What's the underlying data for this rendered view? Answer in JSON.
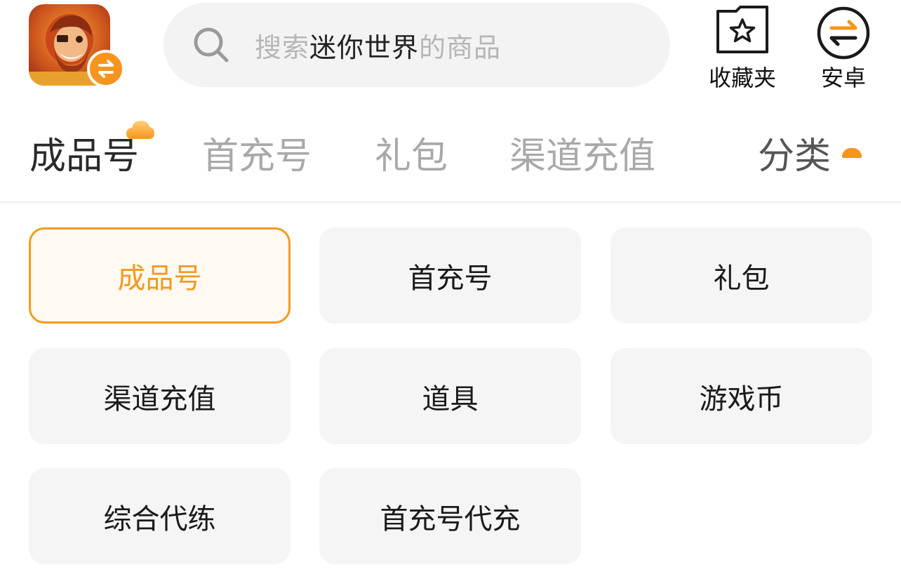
{
  "header": {
    "app_icon_name": "game-app-icon",
    "search": {
      "prefix": "搜索",
      "game": "迷你世界",
      "suffix": "的商品"
    },
    "favorites_label": "收藏夹",
    "platform_label": "安卓"
  },
  "tabs": {
    "items": [
      "成品号",
      "首充号",
      "礼包",
      "渠道充值"
    ],
    "active": "成品号",
    "category_label": "分类"
  },
  "categories": [
    {
      "label": "成品号",
      "selected": true
    },
    {
      "label": "首充号",
      "selected": false
    },
    {
      "label": "礼包",
      "selected": false
    },
    {
      "label": "渠道充值",
      "selected": false
    },
    {
      "label": "道具",
      "selected": false
    },
    {
      "label": "游戏币",
      "selected": false
    },
    {
      "label": "综合代练",
      "selected": false
    },
    {
      "label": "首充号代充",
      "selected": false
    }
  ],
  "colors": {
    "accent": "#f7941d",
    "selected_bg": "#fff9f1",
    "cell_bg": "#f5f5f5",
    "search_bg": "#f3f3f3"
  }
}
